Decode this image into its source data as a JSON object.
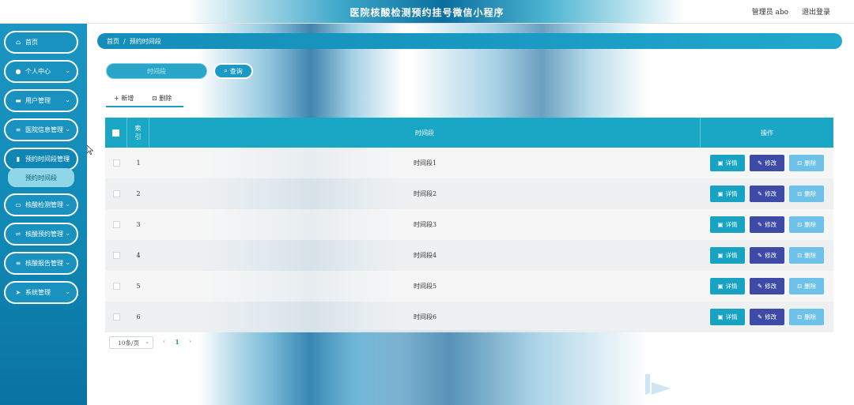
{
  "header": {
    "title": "医院核酸检测预约挂号微信小程序",
    "user_label": "管理员 abo",
    "logout_label": "退出登录"
  },
  "sidebar": {
    "items": [
      {
        "label": "首页",
        "icon": "home-icon",
        "has_chevron": false
      },
      {
        "label": "个人中心",
        "icon": "person-icon",
        "has_chevron": true
      },
      {
        "label": "用户管理",
        "icon": "users-icon",
        "has_chevron": true
      },
      {
        "label": "医院信息管理",
        "icon": "list-icon",
        "has_chevron": true
      },
      {
        "label": "预约时间段管理",
        "icon": "clipboard-icon",
        "has_chevron": true
      },
      {
        "label": "核酸检测管理",
        "icon": "monitor-icon",
        "has_chevron": true
      },
      {
        "label": "核酸预约管理",
        "icon": "sliders-icon",
        "has_chevron": true
      },
      {
        "label": "核酸报告管理",
        "icon": "list-icon",
        "has_chevron": true
      },
      {
        "label": "系统管理",
        "icon": "send-icon",
        "has_chevron": true
      }
    ],
    "active_submenu": "预约时间段"
  },
  "breadcrumb": {
    "home": "首页",
    "separator": "/",
    "current": "预约时间段"
  },
  "search": {
    "placeholder": "时间段",
    "button_label": "查询"
  },
  "actions": {
    "add_label": "新增",
    "delete_label": "删除"
  },
  "table": {
    "headers": {
      "index": "索引",
      "time": "时间段",
      "ops": "操作"
    },
    "rows": [
      {
        "index": "1",
        "time": "时间段1"
      },
      {
        "index": "2",
        "time": "时间段2"
      },
      {
        "index": "3",
        "time": "时间段3"
      },
      {
        "index": "4",
        "time": "时间段4"
      },
      {
        "index": "5",
        "time": "时间段5"
      },
      {
        "index": "6",
        "time": "时间段6"
      }
    ],
    "row_buttons": {
      "detail": "详情",
      "edit": "修改",
      "delete": "删除"
    }
  },
  "pagination": {
    "page_size": "10条/页",
    "current_page": "1",
    "prev": "‹",
    "next": "›"
  },
  "colors": {
    "sidebar": "#118ab7",
    "header_accent": "#0a6fa0",
    "table_header": "#1aa6c5",
    "detail_button": "#18a3c3",
    "edit_button": "#3d4aa6",
    "delete_button": "#6ec2ea"
  }
}
